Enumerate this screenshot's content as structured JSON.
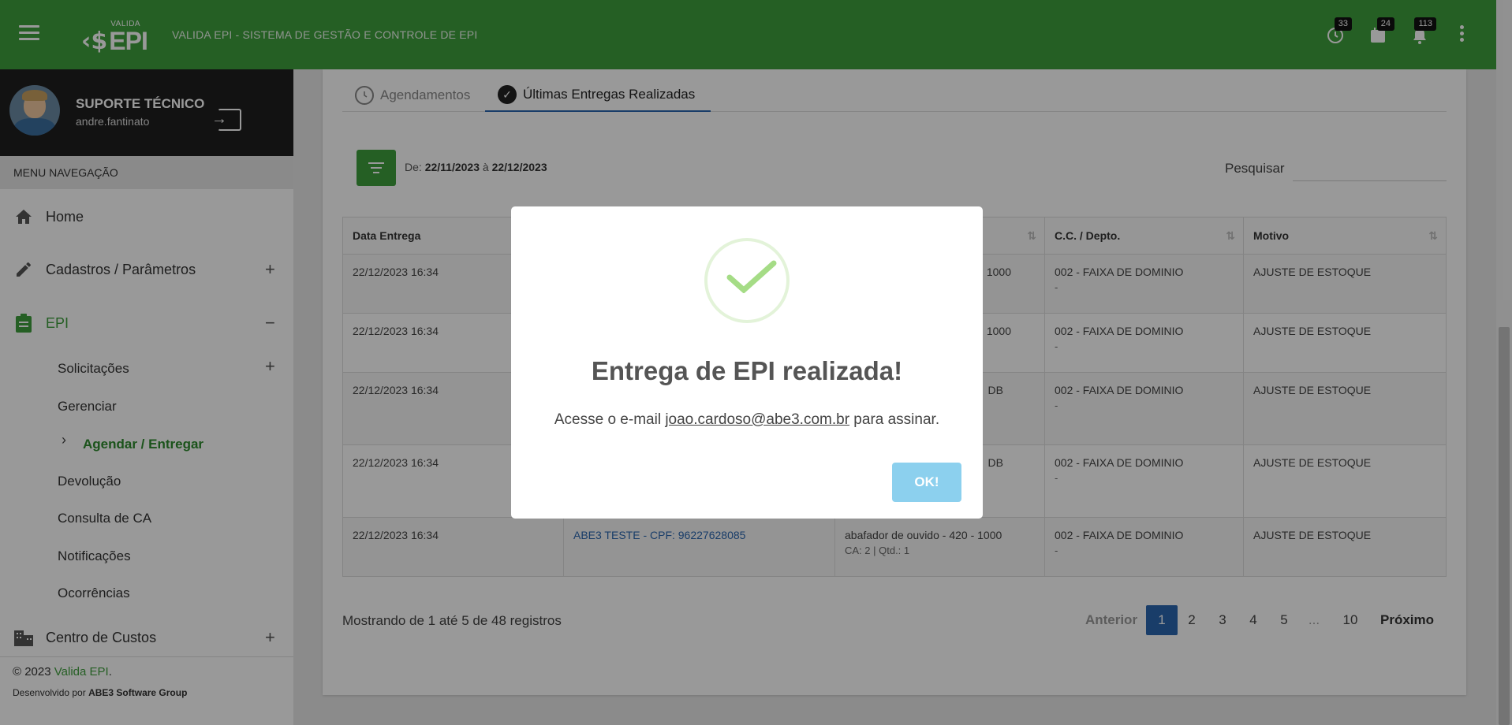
{
  "header": {
    "logo_small": "VALIDA",
    "logo_big": "EPI",
    "title": "VALIDA EPI - SISTEMA DE GESTÃO E CONTROLE DE EPI",
    "badges": {
      "history": "33",
      "calendar": "24",
      "notifications": "113"
    }
  },
  "user": {
    "name": "SUPORTE TÉCNICO",
    "login": "andre.fantinato"
  },
  "sidebar": {
    "menu_header": "MENU NAVEGAÇÃO",
    "items": [
      {
        "label": "Home",
        "icon": "home-icon"
      },
      {
        "label": "Cadastros / Parâmetros",
        "icon": "pencil-icon",
        "toggle": "+"
      },
      {
        "label": "EPI",
        "icon": "clipboard-icon",
        "toggle": "−"
      },
      {
        "label": "Centro de Custos",
        "icon": "building-icon",
        "toggle": "+"
      }
    ],
    "sub_items": [
      {
        "label": "Solicitações",
        "toggle": "+"
      },
      {
        "label": "Gerenciar"
      },
      {
        "label": "Agendar / Entregar"
      },
      {
        "label": "Devolução"
      },
      {
        "label": "Consulta de CA"
      },
      {
        "label": "Notificações"
      },
      {
        "label": "Ocorrências"
      }
    ],
    "footer": {
      "copyright": "© 2023 ",
      "brand": "Valida EPI",
      "brand_suffix": ".",
      "dev_prefix": "Desenvolvido por ",
      "dev_company": "ABE3 Software Group"
    }
  },
  "tabs": [
    {
      "label": "Agendamentos"
    },
    {
      "label": "Últimas Entregas Realizadas"
    }
  ],
  "filter": {
    "prefix": "De:",
    "from": "22/11/2023",
    "sep": "à",
    "to": "22/12/2023"
  },
  "search": {
    "label": "Pesquisar",
    "value": ""
  },
  "table": {
    "columns": [
      "Data Entrega",
      "",
      "",
      "C.C. / Depto.",
      "Motivo"
    ],
    "rows": [
      {
        "date": "22/12/2023 16:34",
        "employee": "",
        "epi": "1000",
        "epi_sub": "",
        "cc": "002 - FAIXA DE DOMINIO",
        "cc_sub": "-",
        "motivo": "AJUSTE DE ESTOQUE"
      },
      {
        "date": "22/12/2023 16:34",
        "employee": "",
        "epi": "1000",
        "epi_sub": "",
        "cc": "002 - FAIXA DE DOMINIO",
        "cc_sub": "-",
        "motivo": "AJUSTE DE ESTOQUE"
      },
      {
        "date": "22/12/2023 16:34",
        "employee": "",
        "epi": "DB",
        "epi_sub": "",
        "cc": "002 - FAIXA DE DOMINIO",
        "cc_sub": "-",
        "motivo": "AJUSTE DE ESTOQUE"
      },
      {
        "date": "22/12/2023 16:34",
        "employee": "",
        "epi": "DB",
        "epi_sub": "",
        "cc": "002 - FAIXA DE DOMINIO",
        "cc_sub": "-",
        "motivo": "AJUSTE DE ESTOQUE"
      },
      {
        "date": "22/12/2023 16:34",
        "employee": "ABE3 TESTE - CPF: 96227628085",
        "epi": "abafador de ouvido - 420 - 1000",
        "epi_sub": "CA: 2 | Qtd.: 1",
        "cc": "002 - FAIXA DE DOMINIO",
        "cc_sub": "-",
        "motivo": "AJUSTE DE ESTOQUE"
      }
    ]
  },
  "pagination": {
    "summary": "Mostrando de 1 até 5 de 48 registros",
    "prev": "Anterior",
    "pages": [
      "1",
      "2",
      "3",
      "4",
      "5",
      "...",
      "10"
    ],
    "next": "Próximo"
  },
  "modal": {
    "title": "Entrega de EPI realizada!",
    "text_prefix": "Acesse o e-mail ",
    "email": "joao.cardoso@abe3.com.br",
    "text_suffix": " para assinar.",
    "ok": "OK!"
  },
  "colors": {
    "brand_green": "#3f9e3d",
    "link_blue": "#2b67b0",
    "ok_button": "#8cd0ee",
    "check_green": "#a5dc86"
  }
}
